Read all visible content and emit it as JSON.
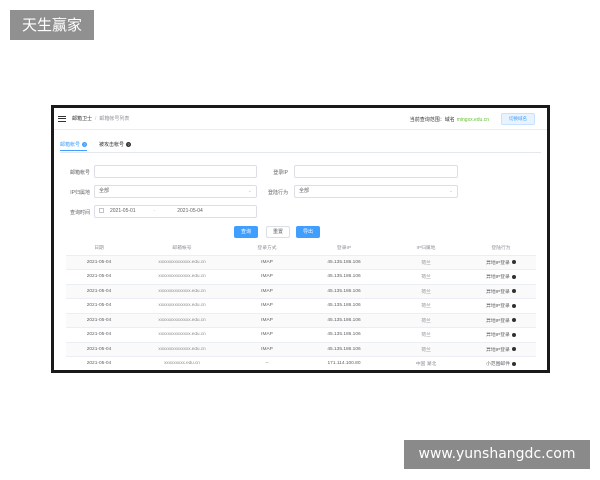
{
  "watermarks": {
    "top_left": "天生赢家",
    "bottom_right": "www.yunshangdc.com"
  },
  "header": {
    "breadcrumb": [
      "邮箱卫士",
      "邮箱帐号列表"
    ],
    "scope_label": "当前查询范围：域名",
    "scope_value": "mingxx.edu.cn",
    "switch_button": "切换域名"
  },
  "tabs": [
    {
      "label": "邮箱帐号"
    },
    {
      "label": "被攻击帐号"
    }
  ],
  "filters": {
    "mailbox_label": "邮箱帐号",
    "mailbox_value": "",
    "login_ip_label": "登录IP",
    "login_ip_value": "",
    "ip_region_label": "IP归属地",
    "ip_region_value": "全部",
    "risk_label": "登陆行为",
    "risk_value": "全部",
    "time_label": "查询时间",
    "date_start": "2021-05-01",
    "date_sep": "-",
    "date_end": "2021-05-04"
  },
  "actions": {
    "search": "查询",
    "reset": "重置",
    "export": "导出"
  },
  "table": {
    "columns": [
      "日期",
      "邮箱帐号",
      "登录方式",
      "登录IP",
      "IP归属地",
      "登陆行为"
    ],
    "rows": [
      [
        "2021-05-04",
        "xxxxxxxxxxxxxx.edu.cn",
        "IMAP",
        "45.135.186.106",
        "荷兰",
        "异地IP登录"
      ],
      [
        "2021-05-04",
        "xxxxxxxxxxxxxx.edu.cn",
        "IMAP",
        "45.135.186.106",
        "荷兰",
        "异地IP登录"
      ],
      [
        "2021-05-04",
        "xxxxxxxxxxxxxx.edu.cn",
        "IMAP",
        "45.135.186.106",
        "荷兰",
        "异地IP登录"
      ],
      [
        "2021-05-04",
        "xxxxxxxxxxxxxx.edu.cn",
        "IMAP",
        "45.135.186.106",
        "荷兰",
        "异地IP登录"
      ],
      [
        "2021-05-04",
        "xxxxxxxxxxxxxx.edu.cn",
        "IMAP",
        "45.135.186.106",
        "荷兰",
        "异地IP登录"
      ],
      [
        "2021-05-04",
        "xxxxxxxxxxxxxx.edu.cn",
        "IMAP",
        "45.135.186.106",
        "荷兰",
        "异地IP登录"
      ],
      [
        "2021-05-04",
        "xxxxxxxxxxxxxx.edu.cn",
        "IMAP",
        "45.135.186.106",
        "荷兰",
        "异地IP登录"
      ],
      [
        "2021-05-04",
        "xxxxxxxxx.edu.cn",
        "--",
        "171.114.100.80",
        "中国 湖北",
        "小范围邮件"
      ]
    ]
  }
}
